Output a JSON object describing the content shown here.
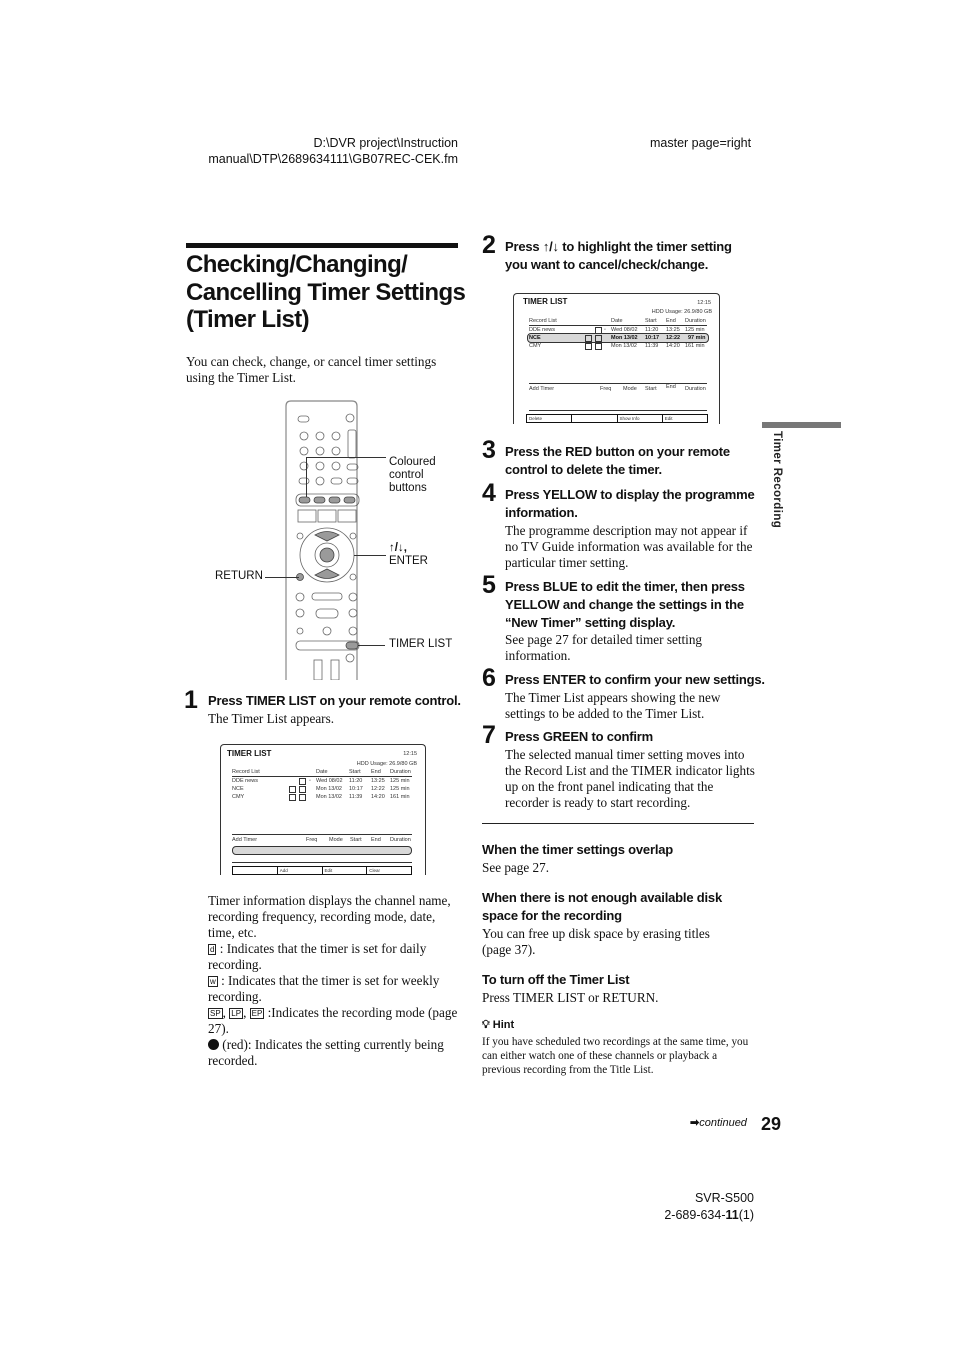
{
  "header": {
    "file_path_line1": "D:\\DVR project\\Instruction",
    "file_path_line2": "manual\\DTP\\2689634111\\GB07REC-CEK.fm",
    "master_page": "master page=right"
  },
  "title": {
    "line1": "Checking/Changing/",
    "line2": "Cancelling Timer Settings",
    "line3": "(Timer List)"
  },
  "intro": "You can check, change, or cancel timer settings using the Timer List.",
  "remote_labels": {
    "coloured": [
      "Coloured",
      "control",
      "buttons"
    ],
    "arrows": "↑/↓,",
    "enter": "ENTER",
    "return": "RETURN",
    "timer_list": "TIMER LIST"
  },
  "steps": [
    {
      "num": "1",
      "heading": "Press  TIMER LIST on your remote control.",
      "body": "The Timer List appears."
    },
    {
      "num": "2",
      "heading": "Press ↑/↓ to highlight the timer setting you want to cancel/check/change.",
      "body": ""
    },
    {
      "num": "3",
      "heading": "Press the RED button on your remote control to delete the timer.",
      "body": ""
    },
    {
      "num": "4",
      "heading": "Press YELLOW to display the programme information.",
      "body": "The programme description may not appear if no TV Guide information was available for the particular timer setting."
    },
    {
      "num": "5",
      "heading": "Press BLUE to edit the timer, then press YELLOW and change the settings in the “New Timer” setting display.",
      "body": "See page 27 for detailed timer setting information."
    },
    {
      "num": "6",
      "heading": "Press ENTER to confirm your new settings.",
      "body": "The Timer List appears showing the new settings to be added to the Timer List."
    },
    {
      "num": "7",
      "heading": "Press GREEN to confirm",
      "body": "The selected manual timer setting moves into the Record List and the TIMER indicator lights up on the front panel indicating that the recorder is ready to start recording."
    }
  ],
  "screen1": {
    "title": "TIMER LIST",
    "clock": "12:15",
    "hdd": "HDD Usage: 26.9/80 GB",
    "record_headers": [
      "Record List",
      "Date",
      "Start",
      "End",
      "Duration"
    ],
    "rows": [
      {
        "name": "DDE news",
        "freq": "",
        "mode": "SP",
        "date": "Wed 08/02",
        "start": "11:20",
        "end": "13:25",
        "duration": "125 min"
      },
      {
        "name": "NCE",
        "freq": "W",
        "mode": "SP",
        "date": "Mon 13/02",
        "start": "10:17",
        "end": "12:22",
        "duration": "125 min"
      },
      {
        "name": "CMY",
        "freq": "D",
        "mode": "SP",
        "date": "Mon 13/02",
        "start": "11:39",
        "end": "14:20",
        "duration": "161 min"
      }
    ],
    "add_headers": [
      "Add Timer",
      "Freq",
      "Mode",
      "Start",
      "End",
      "Duration"
    ],
    "buttons": [
      "",
      "Add",
      "Edit",
      "Clear"
    ]
  },
  "screen2": {
    "title": "TIMER LIST",
    "clock": "12:15",
    "hdd": "HDD Usage: 26.9/80 GB",
    "record_headers": [
      "Record List",
      "Date",
      "Start",
      "End",
      "Duration"
    ],
    "rows": [
      {
        "name": "DDE news",
        "freq": "",
        "mode": "SP",
        "date": "Wed 08/02",
        "start": "11:20",
        "end": "13:25",
        "duration": "125 min"
      },
      {
        "name": "NCE",
        "freq": "W",
        "mode": "SP",
        "date": "Mon 13/02",
        "start": "10:17",
        "end": "12:22",
        "duration": "97 min"
      },
      {
        "name": "CMY",
        "freq": "D",
        "mode": "SP",
        "date": "Mon 13/02",
        "start": "11:39",
        "end": "14:20",
        "duration": "161 min"
      }
    ],
    "add_headers": [
      "Add Timer",
      "Freq",
      "Mode",
      "Start",
      "End",
      "Duration"
    ],
    "buttons": [
      "Delete",
      "",
      "Show Info",
      "Edit"
    ]
  },
  "legend": {
    "intro": "Timer information displays the channel name, recording frequency, recording mode, date, time, etc.",
    "daily_icon": "d",
    "daily": ": Indicates that the timer is set for daily recording.",
    "weekly_icon": "w",
    "weekly": ": Indicates that the timer is set for weekly recording.",
    "mode_icons": [
      "SP",
      "LP",
      "EP"
    ],
    "mode": ":Indicates the recording mode (page 27).",
    "red": " (red): Indicates the setting currently being recorded."
  },
  "notes": [
    {
      "heading": "When the timer settings overlap",
      "body": "See page 27."
    },
    {
      "heading": "When there is not enough available disk space for the recording",
      "body": "You can free up disk space by erasing titles (page 37)."
    },
    {
      "heading": "To turn off the Timer List",
      "body": "Press TIMER LIST or RETURN."
    }
  ],
  "hint": {
    "label": "Hint",
    "body": "If you have scheduled two recordings at the same time, you can either watch one of these channels or playback a previous recording from the Title List."
  },
  "side_tab": "Timer Recording",
  "footer": {
    "continued": "continued",
    "page": "29",
    "model": "SVR-S500",
    "code_prefix": "2-689-634-",
    "code_bold": "11",
    "code_suffix": "(1)"
  }
}
